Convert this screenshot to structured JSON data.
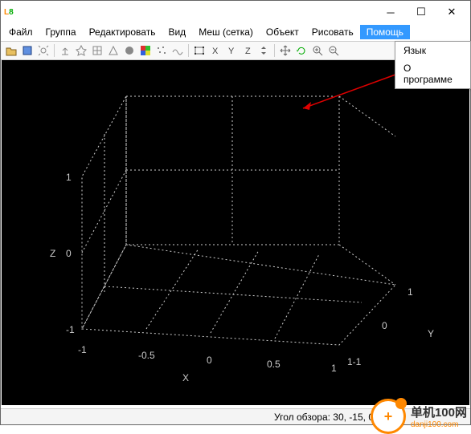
{
  "window": {
    "title": ""
  },
  "menu": {
    "file": "Файл",
    "group": "Группа",
    "edit": "Редактировать",
    "view": "Вид",
    "mesh": "Меш (сетка)",
    "object": "Объект",
    "draw": "Рисовать",
    "help": "Помощь"
  },
  "dropdown": {
    "lang": "Язык",
    "about": "О программе"
  },
  "axes": {
    "x": {
      "label": "X",
      "ticks": [
        "-1",
        "-0.5",
        "0",
        "0.5",
        "1"
      ]
    },
    "y": {
      "label": "Y",
      "ticks": [
        "-1",
        "0",
        "1"
      ]
    },
    "z": {
      "label": "Z",
      "ticks": [
        "-1",
        "0",
        "1"
      ]
    },
    "yx_corner": "1-1"
  },
  "status": {
    "view_angle_label": "Угол обзора:",
    "view_angle_value": "30, -15, 0"
  },
  "watermark": {
    "cn": "单机100网",
    "url": "danji100.com"
  },
  "chart_data": {
    "type": "scatter",
    "title": "",
    "xlabel": "X",
    "ylabel": "Y",
    "zlabel": "Z",
    "xlim": [
      -1,
      1
    ],
    "ylim": [
      -1,
      1
    ],
    "zlim": [
      -1,
      1
    ],
    "x_ticks": [
      -1,
      -0.5,
      0,
      0.5,
      1
    ],
    "y_ticks": [
      -1,
      0,
      1
    ],
    "z_ticks": [
      -1,
      0,
      1
    ],
    "view_angles": [
      30,
      -15,
      0
    ],
    "series": []
  }
}
